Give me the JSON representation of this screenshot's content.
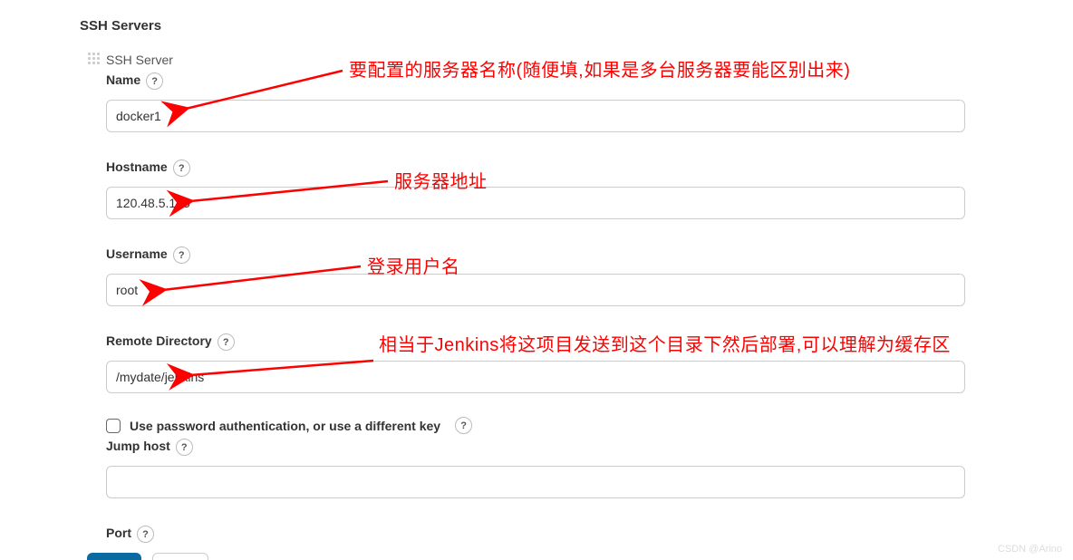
{
  "section_title": "SSH Servers",
  "ssh_server_subtitle": "SSH Server",
  "fields": {
    "name": {
      "label": "Name",
      "value": "docker1"
    },
    "hostname": {
      "label": "Hostname",
      "value": "120.48.5.135"
    },
    "username": {
      "label": "Username",
      "value": "root"
    },
    "remote_dir": {
      "label": "Remote Directory",
      "value": "/mydate/jenkins"
    },
    "jump_host": {
      "label": "Jump host",
      "value": ""
    },
    "port": {
      "label": "Port"
    }
  },
  "checkbox": {
    "label": "Use password authentication, or use a different key"
  },
  "annotations": {
    "name_note": "要配置的服务器名称(随便填,如果是多台服务器要能区别出来)",
    "hostname_note": "服务器地址",
    "username_note": "登录用户名",
    "remote_dir_note": "相当于Jenkins将这项目发送到这个目录下然后部署,可以理解为缓存区"
  },
  "watermark": "CSDN @Arino"
}
